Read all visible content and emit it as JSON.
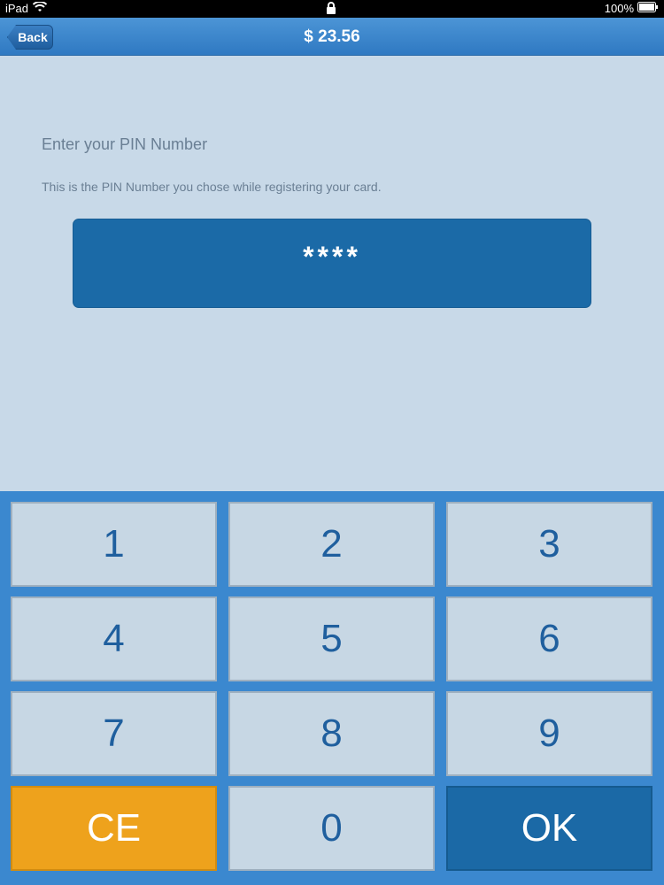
{
  "status_bar": {
    "device": "iPad",
    "battery": "100%"
  },
  "nav": {
    "back_label": "Back",
    "title": "$ 23.56"
  },
  "prompt": {
    "title": "Enter your PIN Number",
    "subtitle": "This is the PIN Number you chose while registering your card."
  },
  "pin_field": {
    "value": "****"
  },
  "keypad": {
    "keys": [
      "1",
      "2",
      "3",
      "4",
      "5",
      "6",
      "7",
      "8",
      "9",
      "CE",
      "0",
      "OK"
    ]
  },
  "colors": {
    "nav_blue": "#3b88cf",
    "ce_orange": "#eea21c",
    "ok_blue": "#1b69a6",
    "key_gray": "#c7d7e4"
  }
}
